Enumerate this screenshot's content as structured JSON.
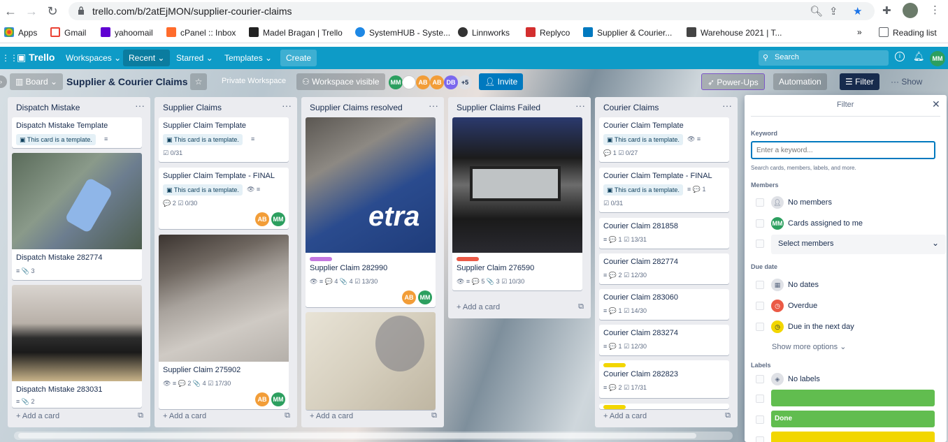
{
  "browser": {
    "url": "trello.com/b/2atEjMON/supplier-courier-claims",
    "bookmarks": [
      {
        "label": "Apps",
        "icon": "apps-grid-icon"
      },
      {
        "label": "Gmail",
        "icon": "gmail-icon"
      },
      {
        "label": "yahoomail",
        "icon": "yahoo-icon"
      },
      {
        "label": "cPanel :: Inbox",
        "icon": "cpanel-icon"
      },
      {
        "label": "Madel Bragan | Trello",
        "icon": "trello-icon"
      },
      {
        "label": "SystemHUB - Syste...",
        "icon": "systemhub-icon"
      },
      {
        "label": "Linnworks",
        "icon": "linnworks-icon"
      },
      {
        "label": "Replyco",
        "icon": "replyco-icon"
      },
      {
        "label": "Supplier & Courier...",
        "icon": "trello-icon"
      },
      {
        "label": "Warehouse 2021 | T...",
        "icon": "trello-icon"
      }
    ],
    "more_bookmarks": "»",
    "reading_list": "Reading list"
  },
  "header": {
    "brand": "Trello",
    "workspaces": "Workspaces",
    "recent": "Recent",
    "starred": "Starred",
    "templates": "Templates",
    "create": "Create",
    "search_placeholder": "Search",
    "user_initials": "MM"
  },
  "board": {
    "view": "Board",
    "title": "Supplier & Courier Claims",
    "workspace": "Private Workspace",
    "visibility": "Workspace visible",
    "members": [
      "MM",
      "",
      "AB",
      "AB",
      "DB"
    ],
    "member_more": "+5",
    "invite": "Invite",
    "power_ups": "Power-Ups",
    "automation": "Automation",
    "filter": "Filter",
    "show_menu": "Show menu"
  },
  "lists": [
    {
      "title": "Dispatch Mistake",
      "cards": [
        {
          "title": "Dispatch Mistake Template",
          "template": "This card is a template.",
          "badges": ""
        },
        {
          "title": "Dispatch Mistake 282774",
          "badges": "≡  📎 3"
        },
        {
          "title": "Dispatch Mistake 283031",
          "badges": "≡  📎 2"
        }
      ],
      "add": "Add a card"
    },
    {
      "title": "Supplier Claims",
      "cards": [
        {
          "title": "Supplier Claim Template",
          "template": "This card is a template.",
          "badges": "☑ 0/31"
        },
        {
          "title": "Supplier Claim Template - FINAL",
          "template": "This card is a template.",
          "badges": "💬 2   ☑ 0/30"
        },
        {
          "title": "Supplier Claim 275902",
          "badges": "👁  ≡  💬 2  📎 4  ☑ 17/30"
        }
      ],
      "add": "Add a card"
    },
    {
      "title": "Supplier Claims resolved",
      "cards": [
        {
          "title": "Supplier Claim 282990",
          "badges": "👁  ≡  💬 4  📎 4  ☑ 13/30"
        }
      ],
      "add": "Add a card"
    },
    {
      "title": "Supplier Claims Failed",
      "cards": [
        {
          "title": "Supplier Claim 276590",
          "badges": "👁  ≡  💬 5  📎 3  ☑ 10/30"
        }
      ],
      "add": "Add a card"
    },
    {
      "title": "Courier Claims",
      "cards": [
        {
          "title": "Courier Claim Template",
          "template": "This card is a template.",
          "badges": "💬 1   ☑ 0/27"
        },
        {
          "title": "Courier Claim Template - FINAL",
          "template": "This card is a template.",
          "badges": "☑ 0/31"
        },
        {
          "title": "Courier Claim 281858",
          "badges": "≡  💬 1  ☑ 13/31"
        },
        {
          "title": "Courier Claim 282774",
          "badges": "≡  💬 2  ☑ 12/30"
        },
        {
          "title": "Courier Claim 283060",
          "badges": "≡  💬 1  ☑ 14/30"
        },
        {
          "title": "Courier Claim 283274",
          "badges": "≡  💬 1  ☑ 12/30"
        },
        {
          "title": "Courier Claim 282823",
          "badges": "≡  💬 2  ☑ 17/31"
        }
      ],
      "add": "Add a card"
    }
  ],
  "filter_panel": {
    "title": "Filter",
    "keyword_label": "Keyword",
    "keyword_placeholder": "Enter a keyword...",
    "keyword_hint": "Search cards, members, labels, and more.",
    "members_label": "Members",
    "no_members": "No members",
    "assigned_to_me": "Cards assigned to me",
    "select_members": "Select members",
    "due_label": "Due date",
    "no_dates": "No dates",
    "overdue": "Overdue",
    "due_next_day": "Due in the next day",
    "show_more": "Show more options",
    "labels_label": "Labels",
    "no_labels": "No labels",
    "label_done": "Done"
  },
  "colors": {
    "trello_blue": "#0e9bc7",
    "green": "#61bd4f",
    "yellow": "#f2d600",
    "red": "#eb5a46",
    "purple": "#c377e0",
    "orange": "#ff9f1a",
    "avatar_green": "#2c9f5f"
  }
}
